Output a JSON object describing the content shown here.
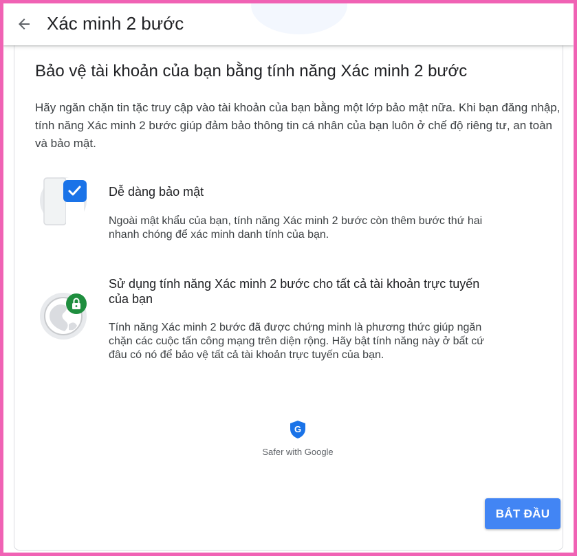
{
  "header": {
    "title": "Xác minh 2 bước",
    "back_icon": "arrow-left-icon"
  },
  "main": {
    "title": "Bảo vệ tài khoản của bạn bằng tính năng Xác minh 2 bước",
    "intro": "Hãy ngăn chặn tin tặc truy cập vào tài khoản của bạn bằng một lớp bảo mật nữa. Khi bạn đăng nhập, tính năng Xác minh 2 bước giúp đảm bảo thông tin cá nhân của bạn luôn ở chế độ riêng tư, an toàn và bảo mật."
  },
  "features": [
    {
      "icon": "phone-checkmark-icon",
      "title": "Dễ dàng bảo mật",
      "description": "Ngoài mật khẩu của bạn, tính năng Xác minh 2 bước còn thêm bước thứ hai nhanh chóng để xác minh danh tính của bạn."
    },
    {
      "icon": "globe-lock-icon",
      "title": "Sử dụng tính năng Xác minh 2 bước cho tất cả tài khoản trực tuyến của bạn",
      "description": "Tính năng Xác minh 2 bước đã được chứng minh là phương thức giúp ngăn chặn các cuộc tấn công mạng trên diện rộng. Hãy bật tính năng này ở bất cứ đâu có nó để bảo vệ tất cả tài khoản trực tuyến của bạn."
    }
  ],
  "safer": {
    "icon": "google-shield-icon",
    "shield_letter": "G",
    "label": "Safer with Google"
  },
  "actions": {
    "start_label": "BẮT ĐẦU"
  },
  "colors": {
    "accent": "#4285f4",
    "check_badge": "#1a73e8",
    "lock_badge": "#1e8e3e",
    "frame": "#f062b4"
  }
}
